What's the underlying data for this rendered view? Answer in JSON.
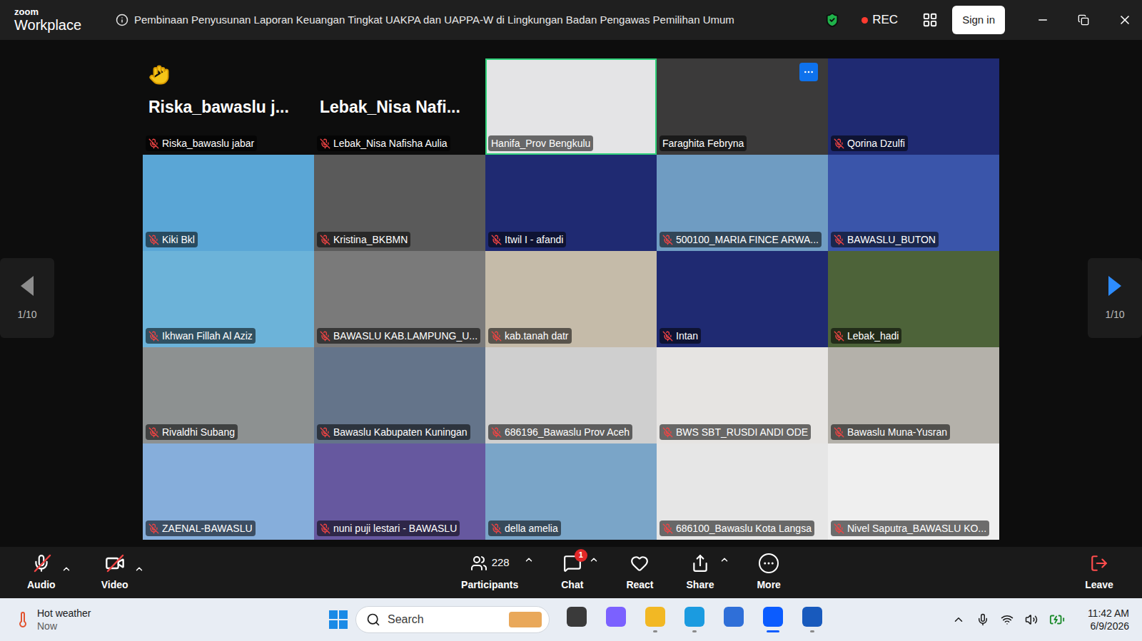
{
  "window": {
    "app_name_small": "zoom",
    "app_name": "Workplace",
    "title": "Pembinaan Penyusunan Laporan Keuangan Tingkat UAKPA dan UAPPA-W di Lingkungan Badan Pengawas Pemilihan Umum",
    "recording_label": "REC",
    "sign_in": "Sign in"
  },
  "gallery": {
    "page_left": "1/10",
    "page_right": "1/10",
    "tiles": [
      {
        "name": "Riska_bawaslu jabar",
        "display_name": "Riska_bawaslu j...",
        "kind": "name",
        "hand_raised": true,
        "muted": true,
        "active_speaker": false,
        "menu_button": false
      },
      {
        "name": "Lebak_Nisa Nafisha Aulia",
        "display_name": "Lebak_Nisa Nafi...",
        "kind": "name",
        "hand_raised": false,
        "muted": true,
        "active_speaker": false,
        "menu_button": false
      },
      {
        "name": "Hanifa_Prov Bengkulu",
        "kind": "video",
        "color": "#e4e4e6",
        "hand_raised": false,
        "muted": false,
        "active_speaker": true,
        "menu_button": false
      },
      {
        "name": "Faraghita Febryna",
        "kind": "video",
        "color": "#3b3a3a",
        "hand_raised": false,
        "muted": false,
        "active_speaker": false,
        "menu_button": true
      },
      {
        "name": "Qorina Dzulfi",
        "kind": "video",
        "color": "#1f2a72",
        "hand_raised": false,
        "muted": true,
        "active_speaker": false,
        "menu_button": false
      },
      {
        "name": "Kiki Bkl",
        "kind": "video",
        "color": "#5aa6d6",
        "hand_raised": false,
        "muted": true,
        "active_speaker": false,
        "menu_button": false
      },
      {
        "name": "Kristina_BKBMN",
        "kind": "video",
        "color": "#5a5a5a",
        "hand_raised": false,
        "muted": true,
        "active_speaker": false,
        "menu_button": false
      },
      {
        "name": "Itwil I - afandi",
        "kind": "video",
        "color": "#1f2a72",
        "hand_raised": false,
        "muted": true,
        "active_speaker": false,
        "menu_button": false
      },
      {
        "name": "500100_MARIA FINCE ARWA...",
        "kind": "video",
        "color": "#6f9cc2",
        "hand_raised": false,
        "muted": true,
        "active_speaker": false,
        "menu_button": false
      },
      {
        "name": "BAWASLU_BUTON",
        "kind": "video",
        "color": "#3a55aa",
        "hand_raised": false,
        "muted": true,
        "active_speaker": false,
        "menu_button": false
      },
      {
        "name": "Ikhwan Fillah Al Aziz",
        "kind": "video",
        "color": "#6cb3d9",
        "hand_raised": false,
        "muted": true,
        "active_speaker": false,
        "menu_button": false
      },
      {
        "name": "BAWASLU KAB.LAMPUNG_U...",
        "kind": "video",
        "color": "#7a7a7a",
        "hand_raised": false,
        "muted": true,
        "active_speaker": false,
        "menu_button": false
      },
      {
        "name": "kab.tanah datr",
        "kind": "video",
        "color": "#c5bba9",
        "hand_raised": false,
        "muted": true,
        "active_speaker": false,
        "menu_button": false
      },
      {
        "name": "Intan",
        "kind": "video",
        "color": "#1f2a72",
        "hand_raised": false,
        "muted": true,
        "active_speaker": false,
        "menu_button": false
      },
      {
        "name": "Lebak_hadi",
        "kind": "video",
        "color": "#4d6339",
        "hand_raised": false,
        "muted": true,
        "active_speaker": false,
        "menu_button": false
      },
      {
        "name": "Rivaldhi Subang",
        "kind": "video",
        "color": "#8d9191",
        "hand_raised": false,
        "muted": true,
        "active_speaker": false,
        "menu_button": false
      },
      {
        "name": "Bawaslu Kabupaten Kuningan",
        "kind": "video",
        "color": "#64748a",
        "hand_raised": false,
        "muted": true,
        "active_speaker": false,
        "menu_button": false
      },
      {
        "name": "686196_Bawaslu Prov Aceh",
        "kind": "video",
        "color": "#cfcfcf",
        "hand_raised": false,
        "muted": true,
        "active_speaker": false,
        "menu_button": false
      },
      {
        "name": "BWS SBT_RUSDI ANDI ODE",
        "kind": "video",
        "color": "#e6e4e2",
        "hand_raised": false,
        "muted": true,
        "active_speaker": false,
        "menu_button": false
      },
      {
        "name": "Bawaslu Muna-Yusran",
        "kind": "video",
        "color": "#b4b1aa",
        "hand_raised": false,
        "muted": true,
        "active_speaker": false,
        "menu_button": false
      },
      {
        "name": "ZAENAL-BAWASLU",
        "kind": "video",
        "color": "#86aedb",
        "hand_raised": false,
        "muted": true,
        "active_speaker": false,
        "menu_button": false
      },
      {
        "name": "nuni puji lestari - BAWASLU",
        "kind": "video",
        "color": "#66589f",
        "hand_raised": false,
        "muted": true,
        "active_speaker": false,
        "menu_button": false
      },
      {
        "name": "della amelia",
        "kind": "video",
        "color": "#7aa5c8",
        "hand_raised": false,
        "muted": true,
        "active_speaker": false,
        "menu_button": false
      },
      {
        "name": "686100_Bawaslu Kota Langsa",
        "kind": "video",
        "color": "#e6e6e6",
        "hand_raised": false,
        "muted": true,
        "active_speaker": false,
        "menu_button": false
      },
      {
        "name": "Nivel Saputra_BAWASLU KO...",
        "kind": "video",
        "color": "#efefef",
        "hand_raised": false,
        "muted": true,
        "active_speaker": false,
        "menu_button": false
      }
    ]
  },
  "toolbar": {
    "audio": {
      "label": "Audio",
      "muted": true
    },
    "video": {
      "label": "Video",
      "off": true
    },
    "participants": {
      "label": "Participants",
      "count": "228"
    },
    "chat": {
      "label": "Chat",
      "badge": "1"
    },
    "react": {
      "label": "React"
    },
    "share": {
      "label": "Share"
    },
    "more": {
      "label": "More"
    },
    "leave": {
      "label": "Leave"
    }
  },
  "taskbar": {
    "weather_title": "Hot weather",
    "weather_sub": "Now",
    "search_placeholder": "Search",
    "time": "11:42 AM",
    "date": "6/9/2026",
    "apps": [
      {
        "color": "#3a3a3a",
        "running": false,
        "active": false
      },
      {
        "color": "#7b61ff",
        "running": false,
        "active": false
      },
      {
        "color": "#f2b824",
        "running": true,
        "active": false
      },
      {
        "color": "#1b9be0",
        "running": true,
        "active": false
      },
      {
        "color": "#2f6fd8",
        "running": false,
        "active": false
      },
      {
        "color": "#0b5cff",
        "running": true,
        "active": true
      },
      {
        "color": "#185abd",
        "running": true,
        "active": false
      }
    ]
  }
}
